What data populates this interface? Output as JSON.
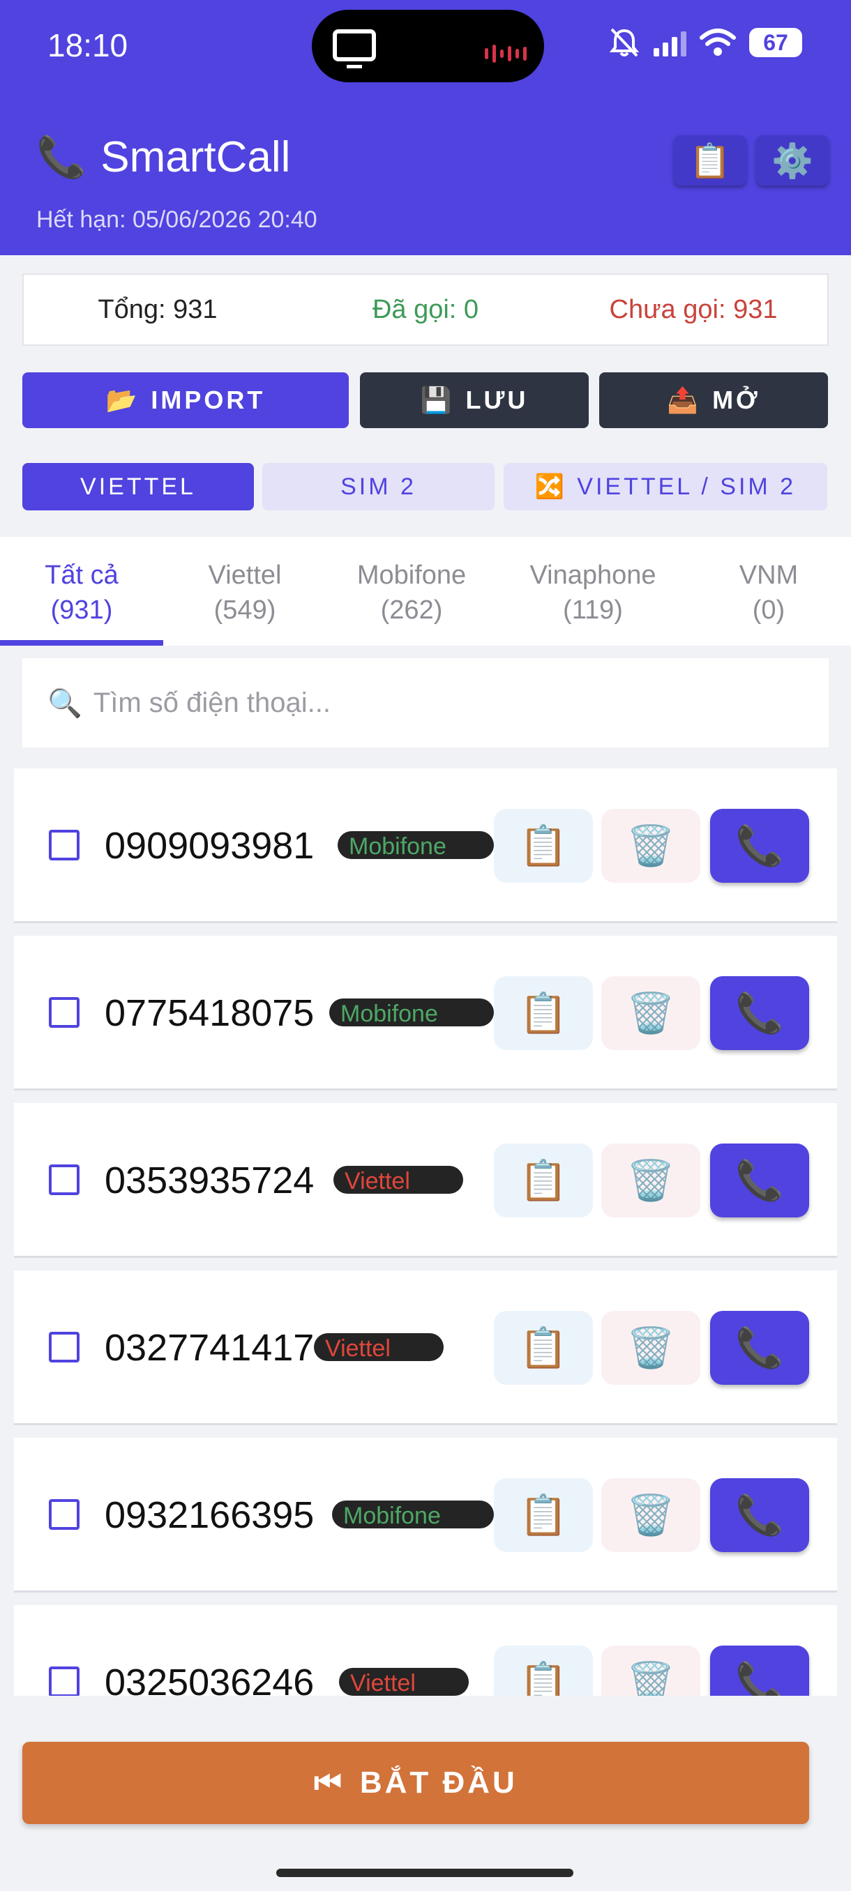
{
  "status_bar": {
    "time": "18:10",
    "battery": "67"
  },
  "header": {
    "title": "SmartCall",
    "title_icon": "phone-receiver-icon",
    "expiry": "Hết hạn: 05/06/2026 20:40",
    "clipboard_icon": "📋",
    "settings_icon": "⚙️"
  },
  "stats": {
    "total": "Tổng: 931",
    "called": "Đã gọi: 0",
    "uncalled": "Chưa gọi: 931"
  },
  "actions": {
    "import": {
      "icon": "📂",
      "label": "IMPORT"
    },
    "save": {
      "icon": "💾",
      "label": "LƯU"
    },
    "open": {
      "icon": "📤",
      "label": "MỞ"
    }
  },
  "sim": {
    "viettel": "VIETTEL",
    "sim2": "SIM 2",
    "both": {
      "icon": "🔀",
      "label": "VIETTEL / SIM 2"
    }
  },
  "tabs": [
    {
      "name": "Tất cả",
      "count": "(931)"
    },
    {
      "name": "Viettel",
      "count": "(549)"
    },
    {
      "name": "Mobifone",
      "count": "(262)"
    },
    {
      "name": "Vinaphone",
      "count": "(119)"
    },
    {
      "name": "VNM",
      "count": "(0)"
    }
  ],
  "search": {
    "icon": "🔍",
    "placeholder": "Tìm số điện thoại..."
  },
  "contacts": [
    {
      "number": "0909093981",
      "carrier": "Mobifone"
    },
    {
      "number": "0775418075",
      "carrier": "Mobifone"
    },
    {
      "number": "0353935724",
      "carrier": "Viettel"
    },
    {
      "number": "0327741417",
      "carrier": "Viettel"
    },
    {
      "number": "0932166395",
      "carrier": "Mobifone"
    },
    {
      "number": "0325036246",
      "carrier": "Viettel"
    }
  ],
  "row_icons": {
    "copy": "📋",
    "delete": "🗑️",
    "call": "📞"
  },
  "start": {
    "icon": "⏮",
    "label": "BẮT ĐẦU"
  },
  "colors": {
    "primary": "#5043df",
    "dark": "#2f3442",
    "start": "#d2733a",
    "mobifone": "#4ea866",
    "viettel": "#e0473b"
  }
}
